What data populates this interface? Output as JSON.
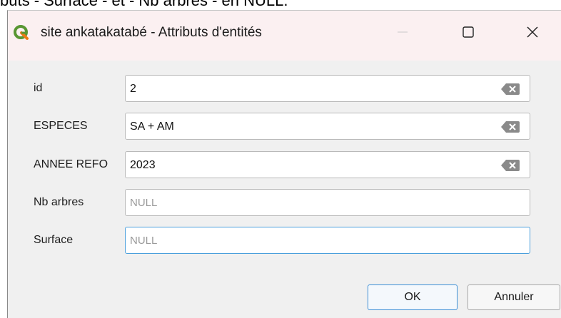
{
  "background": {
    "caption": "buts - Surface - et - Nb arbres - en NULL."
  },
  "window": {
    "title": "site ankatakatabé  - Attributs d'entités",
    "icon": "qgis-logo-icon",
    "controls": [
      "minimize-icon",
      "maximize-icon",
      "close-icon"
    ]
  },
  "form": {
    "fields": [
      {
        "label": "id",
        "value": "2",
        "is_null": false,
        "clearable": true
      },
      {
        "label": "ESPECES",
        "value": "SA + AM",
        "is_null": false,
        "clearable": true
      },
      {
        "label": "ANNEE REFO",
        "value": "2023",
        "is_null": false,
        "clearable": true
      },
      {
        "label": "Nb arbres",
        "value": "NULL",
        "is_null": true,
        "clearable": false
      },
      {
        "label": "Surface",
        "value": "NULL",
        "is_null": true,
        "clearable": false,
        "focused": true
      }
    ]
  },
  "buttons": {
    "ok_label": "OK",
    "cancel_label": "Annuler"
  },
  "colors": {
    "titlebar_bg": "#fbf0f1",
    "dialog_bg": "#f0f0f0",
    "focus_border": "#4a9fdc",
    "qgis_green": "#589632",
    "qgis_yellow": "#ee7913"
  }
}
